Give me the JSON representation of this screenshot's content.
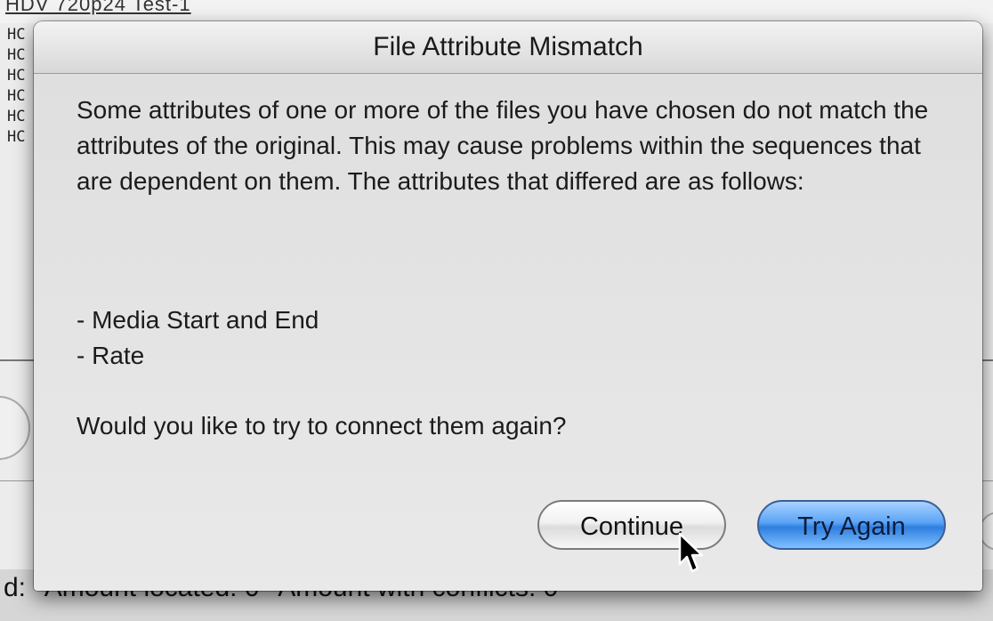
{
  "background": {
    "title_fragment": "HDV 720p24 Test-1",
    "list_fragments": [
      "HC",
      "HC",
      "HC",
      "HC",
      "HC",
      "HC"
    ],
    "footer_fragments": [
      "d:",
      "Amount located: 0",
      "Amount with conflicts: 0"
    ]
  },
  "dialog": {
    "title": "File Attribute Mismatch",
    "message": "Some attributes of one or more of the files you have chosen do not match the attributes of the original. This may cause problems within the sequences that are dependent on them. The attributes that differed are as follows:",
    "attributes": [
      "- Media Start and End",
      "- Rate"
    ],
    "question": "Would you like to try to connect them again?",
    "buttons": {
      "continue": "Continue",
      "try_again": "Try Again"
    }
  },
  "colors": {
    "default_button": "#5aa3f6",
    "dialog_background": "#e7e7e7"
  }
}
